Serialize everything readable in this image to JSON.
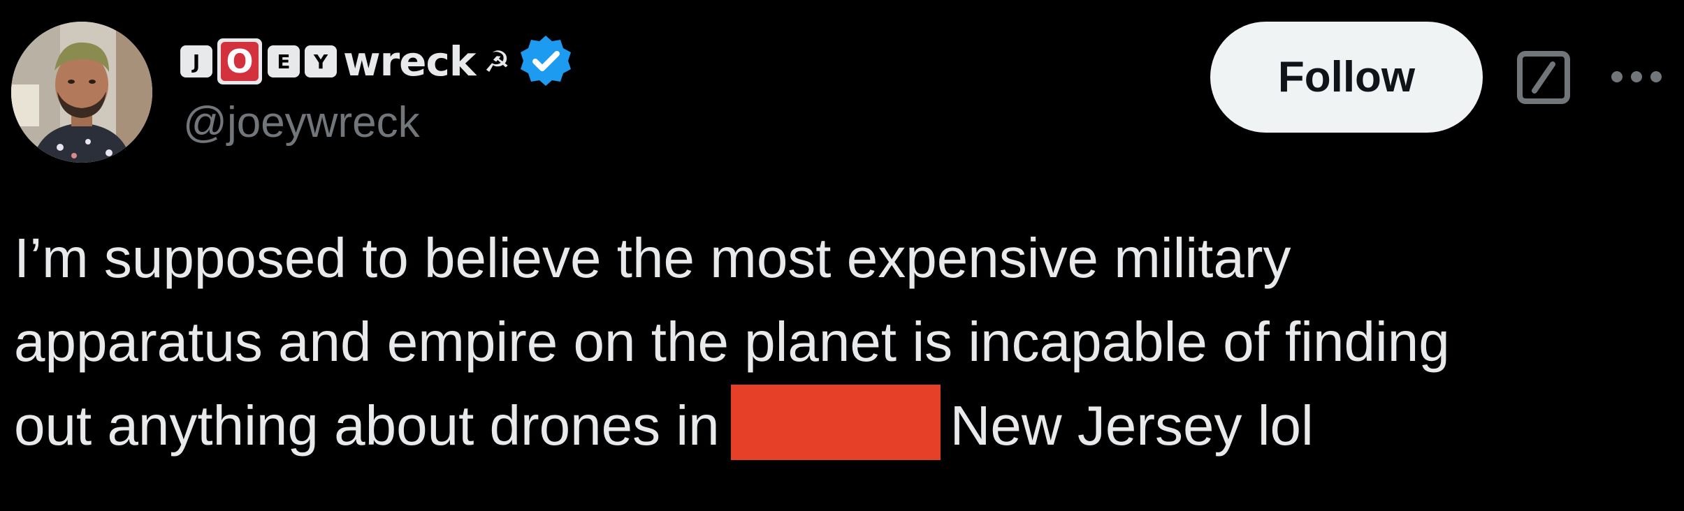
{
  "user": {
    "name_keys": [
      "J",
      "O",
      "E",
      "Y"
    ],
    "name_suffix": "wreck",
    "name_emoji": "☭",
    "handle": "@joeywreck",
    "verified": true
  },
  "actions": {
    "follow_label": "Follow"
  },
  "icons": {
    "verified": "verified-badge-icon",
    "grok": "grok-icon",
    "more": "more-options-icon"
  },
  "colors": {
    "background": "#000000",
    "text": "#e7e9ea",
    "secondary_text": "#71767b",
    "verified_blue": "#1d9bf0",
    "follow_bg": "#eff3f4",
    "redaction": "#e64128",
    "key_red": "#d4313e"
  },
  "tweet": {
    "line1": "I’m supposed to believe the most expensive military",
    "line2": "apparatus and empire on the planet is incapable of finding",
    "line3_before": "out anything about drones in",
    "line3_after": "New Jersey lol"
  }
}
